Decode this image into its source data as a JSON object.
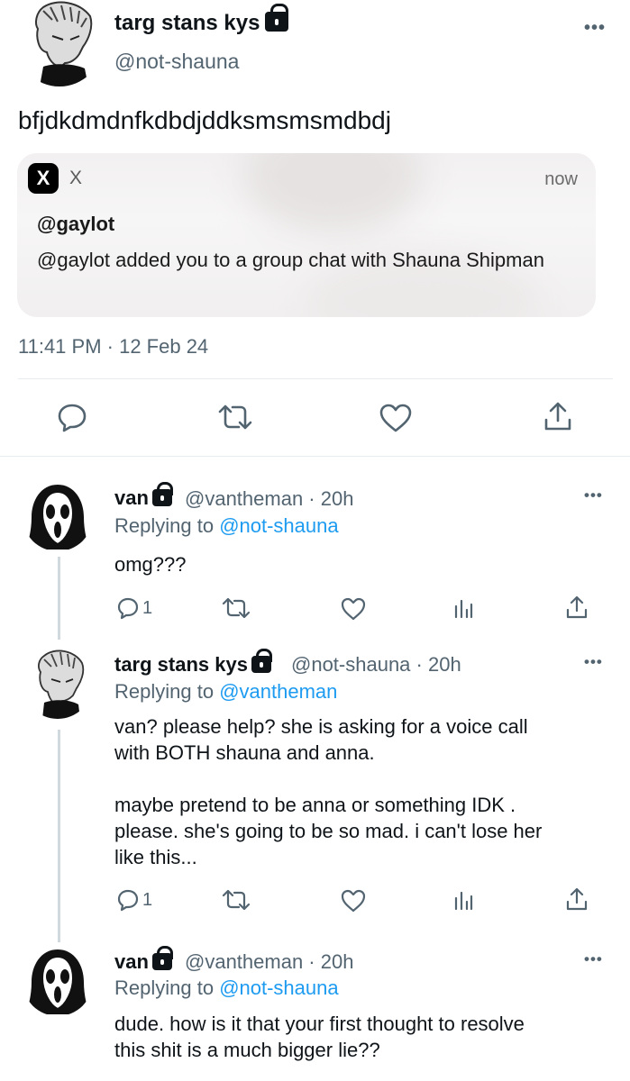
{
  "main_tweet": {
    "name": "targ stans kys",
    "handle": "@not-shauna",
    "text": "bfjdkdmdnfkdbdjddksmsmsmdbdj",
    "notification": {
      "app_icon": "x-logo-icon",
      "app_logo_glyph": "X",
      "app_name": "X",
      "time": "now",
      "title": "@gaylot",
      "body": "@gaylot added you to a group chat with Shauna Shipman"
    },
    "timestamp": "11:41 PM · 12 Feb 24",
    "actions": [
      "reply-icon",
      "retweet-icon",
      "like-icon",
      "share-icon"
    ]
  },
  "replies": [
    {
      "name": "van",
      "meta": "@vantheman · 20h",
      "replying_prefix": "Replying to ",
      "replying_to": "@not-shauna",
      "text": "omg???",
      "reply_count": "1",
      "avatar": "ghostface"
    },
    {
      "name": "targ stans kys",
      "meta": "@not-shauna · 20h",
      "replying_prefix": "Replying to ",
      "replying_to": "@vantheman",
      "text_lines": [
        "van? please help? she is asking for a voice call",
        "with BOTH shauna and anna.",
        "",
        "maybe pretend to be anna or something IDK .",
        "please. she's going to be so mad. i can't lose her",
        "like this..."
      ],
      "reply_count": "1",
      "avatar": "sketch"
    },
    {
      "name": "van",
      "meta": "@vantheman · 20h",
      "replying_prefix": "Replying to ",
      "replying_to": "@not-shauna",
      "text_lines": [
        "dude. how is it that your first thought to resolve",
        "this shit is a much bigger lie??"
      ],
      "avatar": "ghostface"
    }
  ],
  "more_glyph": "•••",
  "colors": {
    "link": "#1d9bf0",
    "secondary": "#536471",
    "text": "#0f1419"
  }
}
